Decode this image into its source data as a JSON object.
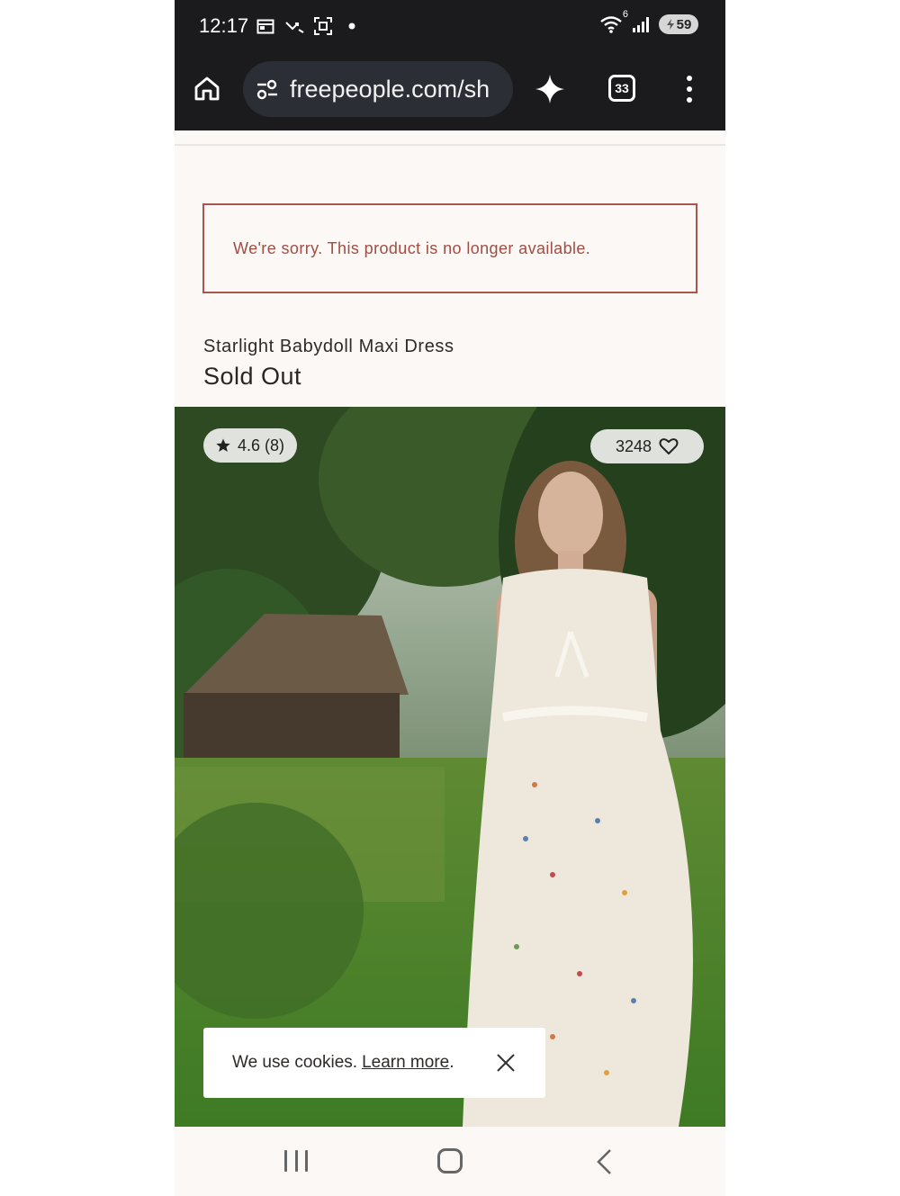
{
  "status_bar": {
    "time": "12:17",
    "wifi_badge": "6",
    "battery": "59",
    "icons": [
      "calendar-icon",
      "missed-call-icon",
      "screenshot-icon",
      "dot-icon",
      "wifi-icon",
      "signal-icon",
      "battery-icon"
    ]
  },
  "browser": {
    "url": "freepeople.com/sh",
    "tab_count": "33",
    "icons": [
      "home-icon",
      "site-settings-icon",
      "sparkle-icon",
      "tabs-icon",
      "more-menu-icon"
    ]
  },
  "page": {
    "alert_message": "We're sorry. This product is no longer available.",
    "product_name": "Starlight Babydoll Maxi Dress",
    "availability": "Sold Out",
    "rating": "4.6 (8)",
    "favorites_count": "3248"
  },
  "cookie_banner": {
    "text": "We use cookies.",
    "link": "Learn more",
    "link_suffix": "."
  },
  "colors": {
    "browser_bar": "#1b1b1d",
    "page_bg": "#fbf8f6",
    "alert_accent": "#a14d43"
  }
}
